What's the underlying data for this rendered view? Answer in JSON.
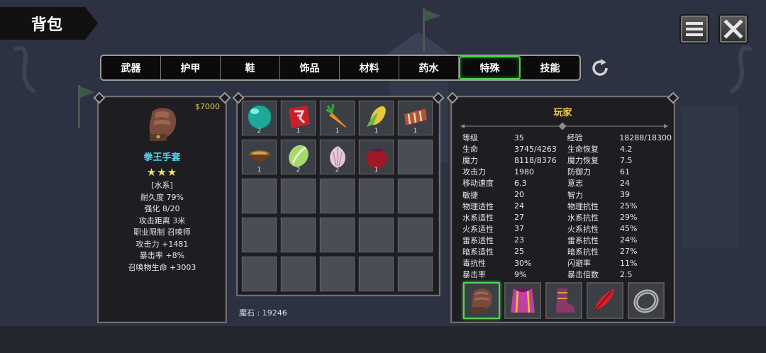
{
  "header": {
    "title": "背包"
  },
  "tabs": [
    {
      "label": "武器"
    },
    {
      "label": "护甲"
    },
    {
      "label": "鞋"
    },
    {
      "label": "饰品"
    },
    {
      "label": "材料"
    },
    {
      "label": "药水"
    },
    {
      "label": "特殊",
      "active": true
    },
    {
      "label": "技能"
    }
  ],
  "item": {
    "price": "$7000",
    "name": "拳王手套",
    "stars": "★★★",
    "lines": [
      "[水系]",
      "耐久度 79%",
      "强化 8/20",
      "攻击距离  3米",
      "职业限制  召唤师",
      "攻击力  +1481",
      "暴击率  +8%",
      "召唤物生命  +3003"
    ]
  },
  "inventory": {
    "cells": [
      {
        "icon": "green-orb-icon",
        "count": "2"
      },
      {
        "icon": "red-rune-icon",
        "count": "1"
      },
      {
        "icon": "carrot-icon",
        "count": "1"
      },
      {
        "icon": "corn-icon",
        "count": "1"
      },
      {
        "icon": "meat-ribs-icon",
        "count": "1"
      },
      {
        "icon": "bowl-icon",
        "count": "1"
      },
      {
        "icon": "cabbage-icon",
        "count": "2"
      },
      {
        "icon": "garlic-icon",
        "count": "2"
      },
      {
        "icon": "red-pouch-icon",
        "count": "1"
      }
    ],
    "magic_stone": "魔石 : 19246"
  },
  "player": {
    "title": "玩家",
    "stats": [
      [
        "等级",
        "35",
        "经验",
        "18288/18300"
      ],
      [
        "生命",
        "3745/4263",
        "生命恢复",
        "4.2"
      ],
      [
        "魔力",
        "8118/8376",
        "魔力恢复",
        "7.5"
      ],
      [
        "攻击力",
        "1980",
        "防御力",
        "61"
      ],
      [
        "移动速度",
        "6.3",
        "意志",
        "24"
      ],
      [
        "敏捷",
        "20",
        "智力",
        "39"
      ],
      [
        "物理适性",
        "24",
        "物理抗性",
        "25%"
      ],
      [
        "水系适性",
        "27",
        "水系抗性",
        "29%"
      ],
      [
        "火系适性",
        "37",
        "火系抗性",
        "45%"
      ],
      [
        "雷系适性",
        "23",
        "雷系抗性",
        "24%"
      ],
      [
        "暗系适性",
        "25",
        "暗系抗性",
        "27%"
      ],
      [
        "毒抗性",
        "30%",
        "闪避率",
        "11%"
      ],
      [
        "暴击率",
        "9%",
        "暴击倍数",
        "2.5"
      ]
    ],
    "equipment": [
      {
        "icon": "gauntlet-icon",
        "active": true
      },
      {
        "icon": "cape-icon"
      },
      {
        "icon": "boots-icon"
      },
      {
        "icon": "feather-icon"
      },
      {
        "icon": "ring-icon"
      }
    ]
  }
}
